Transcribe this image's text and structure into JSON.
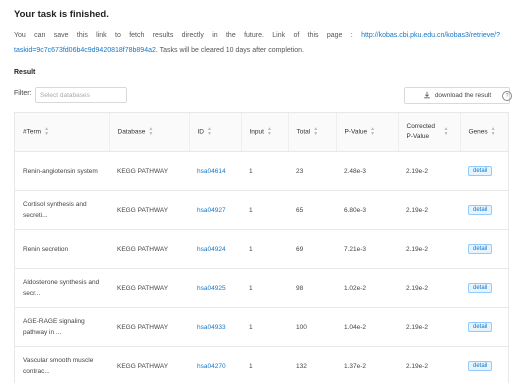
{
  "header": {
    "title": "Your task is finished.",
    "message_prefix": "You can save this link to fetch results directly in the future. Link of this page : ",
    "link": "http://kobas.cbi.pku.edu.cn/kobas3/retrieve/?taskid=9c7c673fd06b4c9d9420818f78b894a2",
    "message_suffix": ". Tasks will be cleared 10 days after completion."
  },
  "result": {
    "label": "Result",
    "filter_label": "Filter:",
    "filter_placeholder": "Select databases",
    "download_label": "download the result",
    "help_glyph": "?"
  },
  "table": {
    "headers": [
      "#Term",
      "Database",
      "ID",
      "Input",
      "Total",
      "P-Value",
      "Corrected P-Value",
      "Genes"
    ],
    "rows": [
      {
        "term": "Renin-angiotensin system",
        "database": "KEGG PATHWAY",
        "id": "hsa04614",
        "input": "1",
        "total": "23",
        "pvalue": "2.48e-3",
        "corrected": "2.19e-2",
        "genes": "detail"
      },
      {
        "term": "Cortisol synthesis and secreti...",
        "database": "KEGG PATHWAY",
        "id": "hsa04927",
        "input": "1",
        "total": "65",
        "pvalue": "6.80e-3",
        "corrected": "2.19e-2",
        "genes": "detail"
      },
      {
        "term": "Renin secretion",
        "database": "KEGG PATHWAY",
        "id": "hsa04924",
        "input": "1",
        "total": "69",
        "pvalue": "7.21e-3",
        "corrected": "2.19e-2",
        "genes": "detail"
      },
      {
        "term": "Aldosterone synthesis and secr...",
        "database": "KEGG PATHWAY",
        "id": "hsa04925",
        "input": "1",
        "total": "98",
        "pvalue": "1.02e-2",
        "corrected": "2.19e-2",
        "genes": "detail"
      },
      {
        "term": "AGE-RAGE signaling pathway in ...",
        "database": "KEGG PATHWAY",
        "id": "hsa04933",
        "input": "1",
        "total": "100",
        "pvalue": "1.04e-2",
        "corrected": "2.19e-2",
        "genes": "detail"
      },
      {
        "term": "Vascular smooth muscle contrac...",
        "database": "KEGG PATHWAY",
        "id": "hsa04270",
        "input": "1",
        "total": "132",
        "pvalue": "1.37e-2",
        "corrected": "2.19e-2",
        "genes": "detail"
      }
    ]
  },
  "colors": {
    "link": "#1677c8",
    "tag_bg": "#e6f4ff",
    "tag_border": "#91caff"
  }
}
